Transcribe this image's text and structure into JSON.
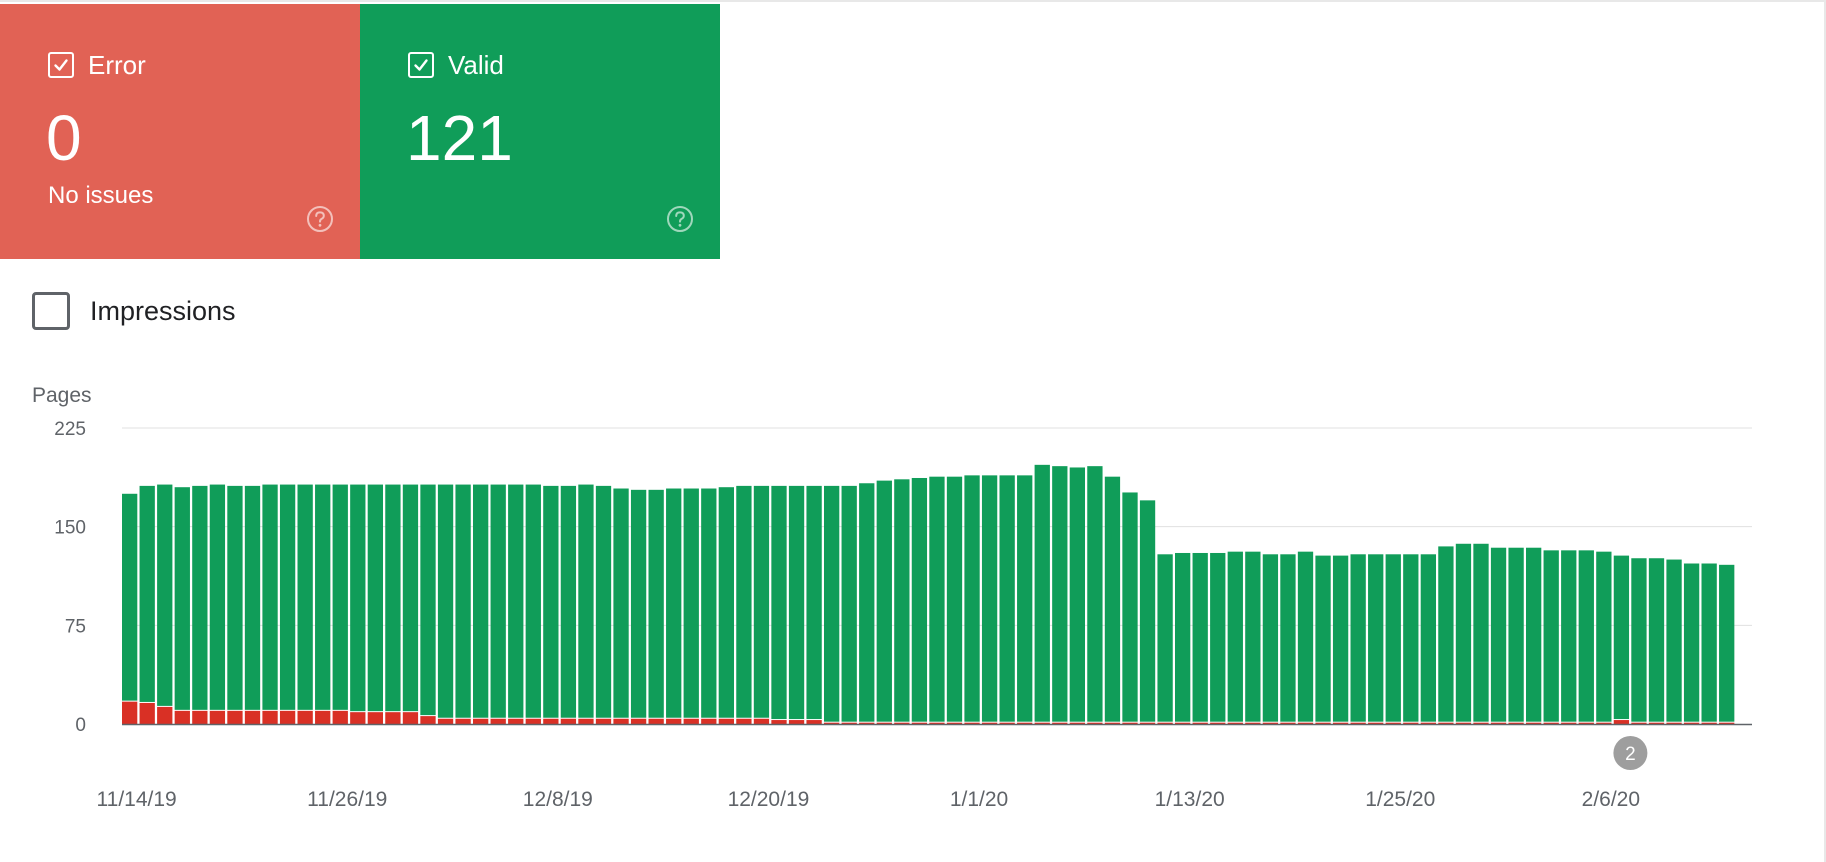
{
  "cards": {
    "error": {
      "label": "Error",
      "count": "0",
      "subtitle": "No issues",
      "color": "#e16255",
      "icon": "help-circle-icon"
    },
    "valid": {
      "label": "Valid",
      "count": "121",
      "color": "#109d59",
      "icon": "help-circle-icon"
    }
  },
  "impressions": {
    "label": "Impressions",
    "checked": false
  },
  "chart_data": {
    "type": "bar",
    "stacked": true,
    "ylabel": "Pages",
    "ylim": [
      0,
      225
    ],
    "yticks": [
      "225",
      "150",
      "75",
      "0"
    ],
    "grid": true,
    "x_tick_labels": [
      "11/14/19",
      "11/26/19",
      "12/8/19",
      "12/20/19",
      "1/1/20",
      "1/13/20",
      "1/25/20",
      "2/6/20"
    ],
    "x_tick_indices": [
      0,
      12,
      24,
      36,
      48,
      60,
      72,
      84
    ],
    "annotation": {
      "text": "2",
      "index": 85
    },
    "colors": {
      "error": "#d93025",
      "valid": "#109d59",
      "grid": "#e0e0e0",
      "axis": "#5f6368",
      "annotation": "#9e9e9e"
    },
    "categories": [
      "11/14/19",
      "11/15/19",
      "11/16/19",
      "11/17/19",
      "11/18/19",
      "11/19/19",
      "11/20/19",
      "11/21/19",
      "11/22/19",
      "11/23/19",
      "11/24/19",
      "11/25/19",
      "11/26/19",
      "11/27/19",
      "11/28/19",
      "11/29/19",
      "11/30/19",
      "12/1/19",
      "12/2/19",
      "12/3/19",
      "12/4/19",
      "12/5/19",
      "12/6/19",
      "12/7/19",
      "12/8/19",
      "12/9/19",
      "12/10/19",
      "12/11/19",
      "12/12/19",
      "12/13/19",
      "12/14/19",
      "12/15/19",
      "12/16/19",
      "12/17/19",
      "12/18/19",
      "12/19/19",
      "12/20/19",
      "12/21/19",
      "12/22/19",
      "12/23/19",
      "12/24/19",
      "12/25/19",
      "12/26/19",
      "12/27/19",
      "12/28/19",
      "12/29/19",
      "12/30/19",
      "12/31/19",
      "1/1/20",
      "1/2/20",
      "1/3/20",
      "1/4/20",
      "1/5/20",
      "1/6/20",
      "1/7/20",
      "1/8/20",
      "1/9/20",
      "1/10/20",
      "1/11/20",
      "1/12/20",
      "1/13/20",
      "1/14/20",
      "1/15/20",
      "1/16/20",
      "1/17/20",
      "1/18/20",
      "1/19/20",
      "1/20/20",
      "1/21/20",
      "1/22/20",
      "1/23/20",
      "1/24/20",
      "1/25/20",
      "1/26/20",
      "1/27/20",
      "1/28/20",
      "1/29/20",
      "1/30/20",
      "1/31/20",
      "2/1/20",
      "2/2/20",
      "2/3/20",
      "2/4/20",
      "2/5/20",
      "2/6/20",
      "2/7/20",
      "2/8/20",
      "2/9/20",
      "2/10/20",
      "2/11/20",
      "2/12/20",
      "2/13/20"
    ],
    "series": [
      {
        "name": "Error",
        "values": [
          17,
          16,
          13,
          10,
          10,
          10,
          10,
          10,
          10,
          10,
          10,
          10,
          10,
          9,
          9,
          9,
          9,
          6,
          4,
          4,
          4,
          4,
          4,
          4,
          4,
          4,
          4,
          4,
          4,
          4,
          4,
          4,
          4,
          4,
          4,
          4,
          4,
          3,
          3,
          3,
          1,
          1,
          1,
          1,
          1,
          1,
          1,
          1,
          1,
          1,
          1,
          1,
          1,
          1,
          1,
          1,
          1,
          1,
          1,
          1,
          1,
          1,
          1,
          1,
          1,
          1,
          1,
          1,
          1,
          1,
          1,
          1,
          1,
          1,
          1,
          1,
          1,
          1,
          1,
          1,
          1,
          1,
          1,
          1,
          1,
          3,
          1,
          1,
          1,
          1,
          1,
          1
        ]
      },
      {
        "name": "Valid",
        "values": [
          158,
          165,
          169,
          170,
          171,
          172,
          171,
          171,
          172,
          172,
          172,
          172,
          172,
          173,
          173,
          173,
          173,
          176,
          178,
          178,
          178,
          178,
          178,
          178,
          177,
          177,
          178,
          177,
          175,
          174,
          174,
          175,
          175,
          175,
          176,
          177,
          177,
          178,
          178,
          178,
          180,
          180,
          182,
          184,
          185,
          186,
          187,
          187,
          188,
          188,
          188,
          188,
          196,
          195,
          194,
          195,
          187,
          175,
          169,
          128,
          129,
          129,
          129,
          130,
          130,
          128,
          128,
          130,
          127,
          127,
          128,
          128,
          128,
          128,
          128,
          134,
          136,
          136,
          133,
          133,
          133,
          131,
          131,
          131,
          130,
          125,
          125,
          125,
          124,
          121,
          121,
          120
        ]
      }
    ]
  }
}
